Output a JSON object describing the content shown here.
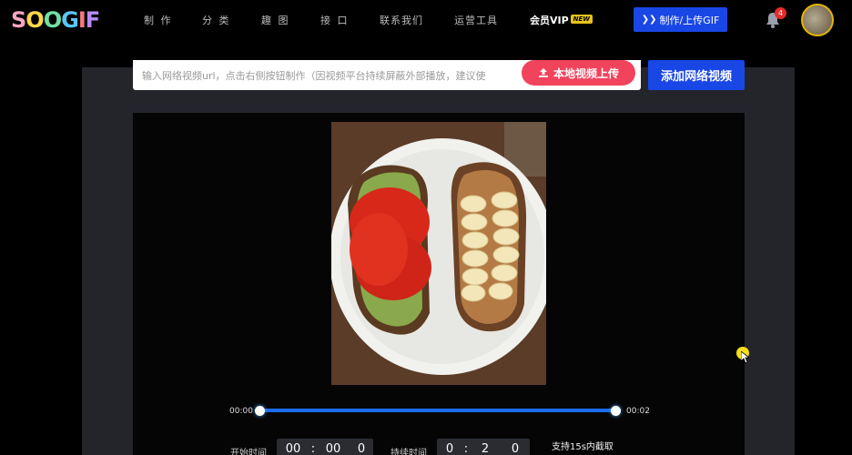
{
  "header": {
    "logo_text": [
      "S",
      "O",
      "O",
      "G",
      "I",
      "F"
    ],
    "logo_colors": [
      "#f6a5c0",
      "#ffd84a",
      "#6fe0a4",
      "#59c7f4",
      "#f57a7a",
      "#b58cf5"
    ],
    "nav": [
      "制 作",
      "分 类",
      "趣 图",
      "接 口",
      "联系我们",
      "运营工具"
    ],
    "vip_label": "会员VIP",
    "vip_badge": "NEW",
    "make_button": "制作/上传GIF",
    "notification_count": "4"
  },
  "upload": {
    "url_placeholder": "输入网络视频url，点击右侧按钮制作（因视频平台持续屏蔽外部播放，建议使",
    "local_upload_label": "本地视频上传",
    "add_video_label": "添加网络视频"
  },
  "timeline": {
    "start_label": "00:00",
    "end_label": "00:02",
    "range_start_fraction": 0,
    "range_end_fraction": 1
  },
  "time_inputs": {
    "start_label": "开始时间",
    "start_value": [
      "00",
      "00",
      "0"
    ],
    "duration_label": "持续时间",
    "duration_value": [
      "0",
      "2",
      "0"
    ],
    "note": "支持15s内截取"
  },
  "colors": {
    "accent_blue": "#1947e6",
    "upload_red": "#f2435c",
    "track_blue": "#1a6cf0",
    "badge_red": "#e52b2b"
  }
}
